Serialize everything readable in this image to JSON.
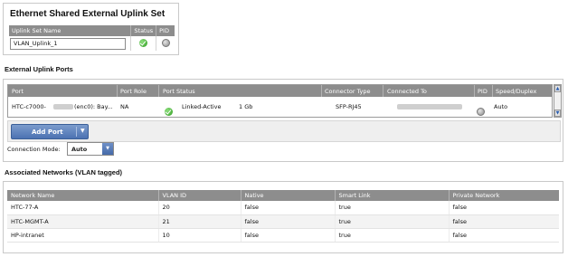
{
  "uplink_set": {
    "title": "Ethernet Shared External Uplink Set",
    "columns": [
      "Uplink Set Name",
      "Status",
      "PID"
    ],
    "name_value": "VLAN_Uplink_1",
    "status_icon": "ok-icon",
    "pid_icon": "pid-icon"
  },
  "external_ports": {
    "title": "External Uplink Ports",
    "columns": {
      "port": "Port",
      "port_role": "Port Role",
      "port_status": "Port Status",
      "connector_type": "Connector Type",
      "connected_to": "Connected To",
      "pid": "PID",
      "speed_duplex": "Speed/Duplex"
    },
    "row": {
      "port_prefix": "HTC-c7000-",
      "port_suffix": "(enc0): Bay...",
      "port_role": "NA",
      "status_icon": "ok-icon",
      "status": "Linked-Active",
      "speed": "1 Gb",
      "connector_type": "SFP-RJ45",
      "speed_duplex": "Auto"
    },
    "add_port_label": "Add Port",
    "connection_mode_label": "Connection Mode:",
    "connection_mode_value": "Auto"
  },
  "networks": {
    "title": "Associated Networks (VLAN tagged)",
    "columns": [
      "Network Name",
      "VLAN ID",
      "Native",
      "Smart Link",
      "Private Network"
    ],
    "rows": [
      {
        "name": "HTC-77-A",
        "vlan": "20",
        "native": "false",
        "smart_link": "true",
        "private": "false"
      },
      {
        "name": "HTC-MGMT-A",
        "vlan": "21",
        "native": "false",
        "smart_link": "true",
        "private": "false"
      },
      {
        "name": "HP-intranet",
        "vlan": "10",
        "native": "false",
        "smart_link": "true",
        "private": "false"
      }
    ]
  },
  "colors": {
    "header_gray": "#8d8d8d",
    "button_blue": "#4c72b2",
    "status_green": "#2e9b1f"
  }
}
